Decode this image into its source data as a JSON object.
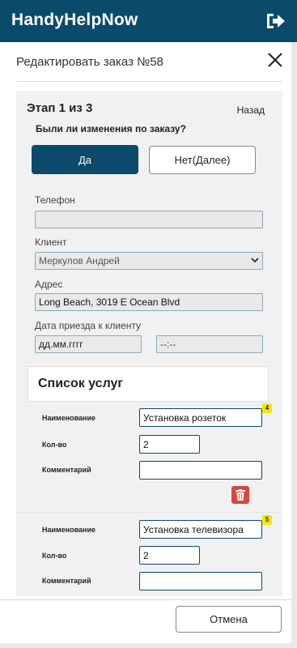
{
  "app": {
    "title": "HandyHelpNow",
    "logout_icon": "logout-icon"
  },
  "modal": {
    "title": "Редактировать заказ №58",
    "step": "Этап 1 из 3",
    "back_label": "Назад",
    "question": "Были ли изменения по заказу?",
    "yes_label": "Да",
    "no_label": "Нет(Далее)",
    "phone": {
      "label": "Телефон",
      "value": ""
    },
    "client": {
      "label": "Клиент",
      "value": "Меркулов Андрей"
    },
    "address": {
      "label": "Адрес",
      "value": "Long Beach, 3019 E Ocean Blvd"
    },
    "arrival": {
      "label": "Дата приезда к клиенту",
      "date_placeholder": "дд.мм.гггг",
      "time_placeholder": "--:--"
    },
    "services": {
      "title": "Список услуг",
      "name_label": "Наименование",
      "qty_label": "Кол-во",
      "comment_label": "Комментарий",
      "items": [
        {
          "badge": "4",
          "name": "Установка розеток",
          "qty": "2",
          "comment": ""
        },
        {
          "badge": "5",
          "name": "Установка телевизора",
          "qty": "2",
          "comment": ""
        }
      ]
    },
    "cancel_label": "Отмена"
  },
  "colors": {
    "primary": "#0b4a6a",
    "danger": "#d9473d",
    "badge": "#f5e800"
  }
}
